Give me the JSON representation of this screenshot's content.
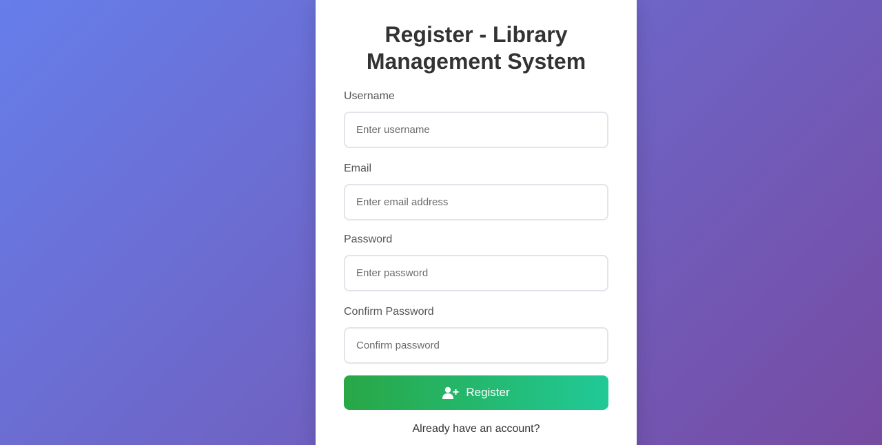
{
  "form": {
    "title": "Register - Library Management System",
    "fields": [
      {
        "label": "Username",
        "placeholder": "Enter username",
        "value": ""
      },
      {
        "label": "Email",
        "placeholder": "Enter email address",
        "value": ""
      },
      {
        "label": "Password",
        "placeholder": "Enter password",
        "value": ""
      },
      {
        "label": "Confirm Password",
        "placeholder": "Confirm password",
        "value": ""
      }
    ],
    "submit_label": "Register",
    "submit_icon": "user-plus-icon",
    "footer_text": "Already have an account?"
  },
  "colors": {
    "background_start": "#667eea",
    "background_end": "#764ba2",
    "button_start": "#28a745",
    "button_end": "#20c997",
    "title": "#333333",
    "label": "#555555"
  }
}
